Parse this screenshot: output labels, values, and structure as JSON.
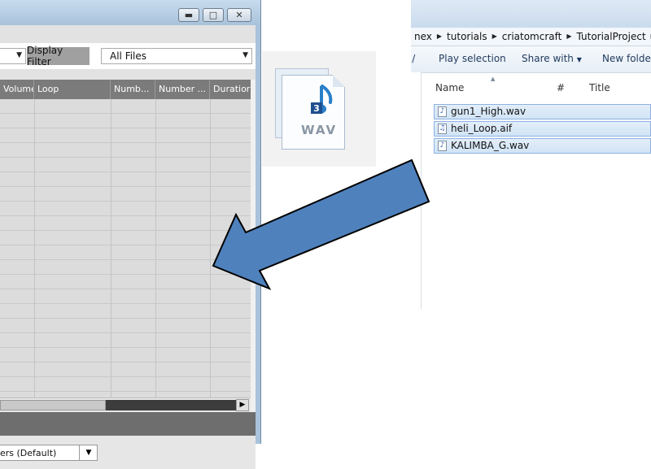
{
  "left_window": {
    "filter": {
      "display_filter_label": "Display Filter",
      "selected_value": "All Files"
    },
    "grid": {
      "columns": [
        "Volume",
        "Loop",
        "Numb...",
        "Number ...",
        "Duratior"
      ]
    },
    "bottom_select_value": "ers (Default)"
  },
  "wav_icon": {
    "label": "WAV",
    "badge_number": "3"
  },
  "explorer": {
    "breadcrumb": [
      "nex",
      "tutorials",
      "criatomcraft",
      "TutorialProject"
    ],
    "toolbar": {
      "play_selection": "Play selection",
      "share_with": "Share with",
      "new_folder": "New folder"
    },
    "columns": {
      "name": "Name",
      "number": "#",
      "title": "Title"
    },
    "files": [
      {
        "name": "gun1_High.wav",
        "icon": "audio-file-icon"
      },
      {
        "name": "heli_Loop.aif",
        "icon": "audio-aif-file-icon"
      },
      {
        "name": "KALIMBA_G.wav",
        "icon": "audio-file-icon"
      }
    ]
  },
  "colors": {
    "arrow_fill": "#4f81bd",
    "arrow_stroke": "#000000",
    "window_frame": "#a9c3db",
    "grid_header": "#7b7b7b"
  }
}
